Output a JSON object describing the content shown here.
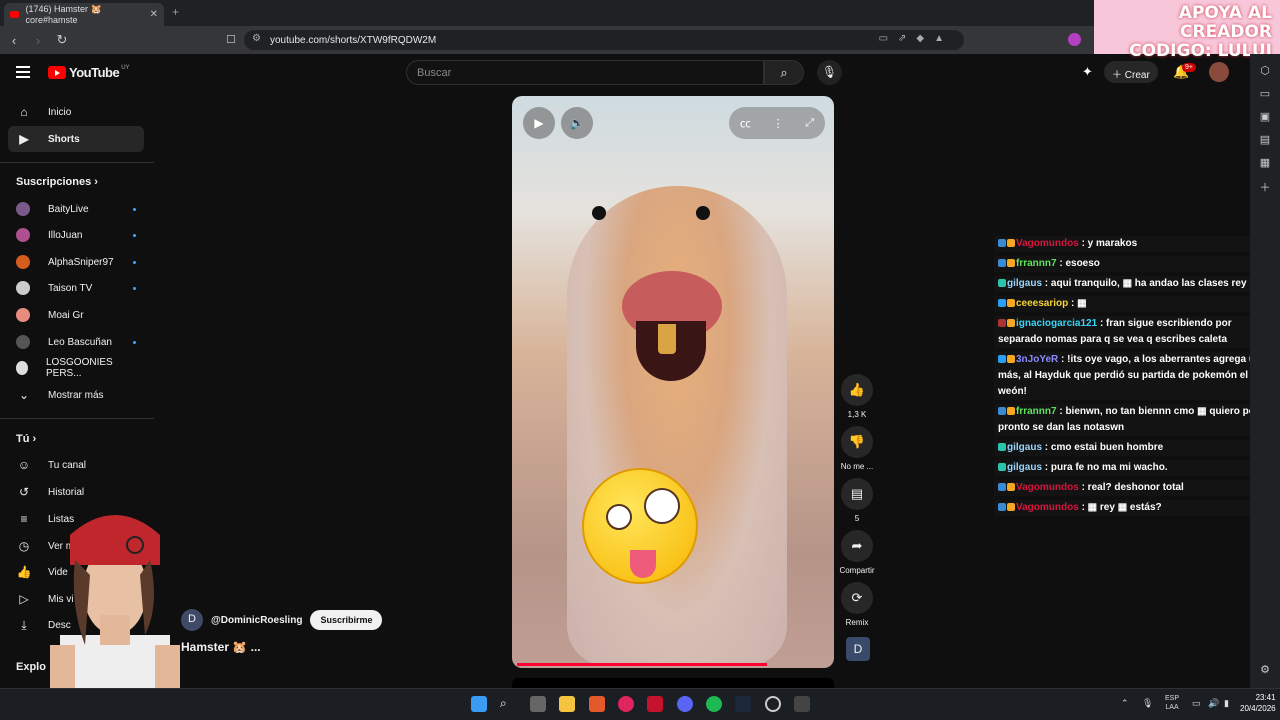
{
  "browser": {
    "tab_title": "(1746) Hamster 🐹 core#hamste",
    "url": "youtube.com/shorts/XTW9fRQDW2M"
  },
  "banner": {
    "line1": "APOYA AL CREADOR",
    "line2": "CODIGO: LULUI"
  },
  "youtube": {
    "logo": "YouTube",
    "region": "UY",
    "search_placeholder": "Buscar",
    "create_label": "Crear",
    "notif_count": "9+"
  },
  "sidebar": {
    "main": [
      {
        "label": "Inicio",
        "icon": "home-icon"
      },
      {
        "label": "Shorts",
        "icon": "shorts-icon"
      }
    ],
    "subs_header": "Suscripciones",
    "subs": [
      {
        "label": "BaityLive",
        "color": "#7a5a8a"
      },
      {
        "label": "IlloJuan",
        "color": "#b04f8f"
      },
      {
        "label": "AlphaSniper97",
        "color": "#d65c1e"
      },
      {
        "label": "Taison TV",
        "color": "#cccccc"
      },
      {
        "label": "Moai Gr",
        "color": "#e88c7d"
      },
      {
        "label": "Leo Bascuñan",
        "color": "#555555"
      },
      {
        "label": "LOSGOONIES PERS...",
        "color": "#dddddd"
      }
    ],
    "show_more": "Mostrar más",
    "you_header": "Tú",
    "you": [
      {
        "label": "Tu canal"
      },
      {
        "label": "Historial"
      },
      {
        "label": "Listas"
      },
      {
        "label": "Ver m"
      },
      {
        "label": "Vide"
      },
      {
        "label": "Mis vi"
      },
      {
        "label": "Desc"
      }
    ],
    "explore": "Explo"
  },
  "short": {
    "channel": "@DominicRoesling",
    "channel_initial": "D",
    "subscribe": "Suscribirme",
    "title": "Hamster 🐹 ...",
    "progress": 0.78
  },
  "actions": [
    {
      "label": "1,3 K",
      "icon": "like-icon"
    },
    {
      "label": "No me ...",
      "icon": "dislike-icon"
    },
    {
      "label": "5",
      "icon": "comment-icon"
    },
    {
      "label": "Compartir",
      "icon": "share-icon"
    },
    {
      "label": "Remix",
      "icon": "remix-icon"
    }
  ],
  "chat": [
    {
      "user": "Vagomundos",
      "color": "#d6153f",
      "text": ": y marakos"
    },
    {
      "user": "frrannn7",
      "color": "#5fe35f",
      "text": ": esoeso"
    },
    {
      "user": "gilgaus",
      "color": "#9ad6ff",
      "text": ": aqui tranquilo, ▦ ha andao las clases rey"
    },
    {
      "user": "ceeesariop",
      "color": "#f7d336",
      "text": ": ▦"
    },
    {
      "user": "ignaciogarcia121",
      "color": "#36d6f7",
      "text": ": fran sigue escribiendo por separado nomas para q se vea q escribes caleta"
    },
    {
      "user": "3nJoYeR",
      "color": "#8a8aff",
      "text": ": !its oye vago, a los aberrantes agrega uno más, al Hayduk que perdió su partida de pokemón el weón!"
    },
    {
      "user": "frrannn7",
      "color": "#5fe35f",
      "text": ": bienwn, no tan biennn cmo ▦ quiero pero pronto se dan las notaswn"
    },
    {
      "user": "gilgaus",
      "color": "#9ad6ff",
      "text": ": cmo estai buen hombre"
    },
    {
      "user": "gilgaus",
      "color": "#9ad6ff",
      "text": ": pura fe no ma mi wacho."
    },
    {
      "user": "Vagomundos",
      "color": "#d6153f",
      "text": ": real? deshonor total"
    },
    {
      "user": "Vagomundos",
      "color": "#d6153f",
      "text": ": ▦ rey ▦ estás?"
    }
  ],
  "taskbar": {
    "lang1": "ESP",
    "lang2": "LAA",
    "time": "23:41",
    "date": "20/4/2026"
  }
}
